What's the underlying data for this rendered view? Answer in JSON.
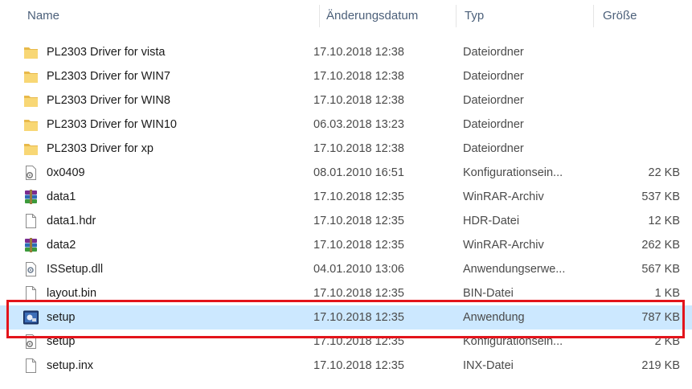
{
  "columns": {
    "name": "Name",
    "date": "Änderungsdatum",
    "type": "Typ",
    "size": "Größe"
  },
  "files": [
    {
      "name": "PL2303 Driver for vista",
      "date": "17.10.2018 12:38",
      "type": "Dateiordner",
      "size": "",
      "icon": "folder-icon"
    },
    {
      "name": "PL2303 Driver for WIN7",
      "date": "17.10.2018 12:38",
      "type": "Dateiordner",
      "size": "",
      "icon": "folder-icon"
    },
    {
      "name": "PL2303 Driver for WIN8",
      "date": "17.10.2018 12:38",
      "type": "Dateiordner",
      "size": "",
      "icon": "folder-icon"
    },
    {
      "name": "PL2303 Driver for WIN10",
      "date": "06.03.2018 13:23",
      "type": "Dateiordner",
      "size": "",
      "icon": "folder-icon"
    },
    {
      "name": "PL2303 Driver for xp",
      "date": "17.10.2018 12:38",
      "type": "Dateiordner",
      "size": "",
      "icon": "folder-icon"
    },
    {
      "name": "0x0409",
      "date": "08.01.2010 16:51",
      "type": "Konfigurationsein...",
      "size": "22 KB",
      "icon": "config-file-icon"
    },
    {
      "name": "data1",
      "date": "17.10.2018 12:35",
      "type": "WinRAR-Archiv",
      "size": "537 KB",
      "icon": "winrar-archive-icon"
    },
    {
      "name": "data1.hdr",
      "date": "17.10.2018 12:35",
      "type": "HDR-Datei",
      "size": "12 KB",
      "icon": "blank-file-icon"
    },
    {
      "name": "data2",
      "date": "17.10.2018 12:35",
      "type": "WinRAR-Archiv",
      "size": "262 KB",
      "icon": "winrar-archive-icon"
    },
    {
      "name": "ISSetup.dll",
      "date": "04.01.2010 13:06",
      "type": "Anwendungserwe...",
      "size": "567 KB",
      "icon": "dll-file-icon"
    },
    {
      "name": "layout.bin",
      "date": "17.10.2018 12:35",
      "type": "BIN-Datei",
      "size": "1 KB",
      "icon": "blank-file-icon"
    },
    {
      "name": "setup",
      "date": "17.10.2018 12:35",
      "type": "Anwendung",
      "size": "787 KB",
      "icon": "setup-app-icon",
      "selected": true
    },
    {
      "name": "setup",
      "date": "17.10.2018 12:35",
      "type": "Konfigurationsein...",
      "size": "2 KB",
      "icon": "config-file-icon"
    },
    {
      "name": "setup.inx",
      "date": "17.10.2018 12:35",
      "type": "INX-Datei",
      "size": "219 KB",
      "icon": "blank-file-icon"
    }
  ],
  "colors": {
    "header_text": "#4c607a",
    "selection": "#cce8ff",
    "highlight_border": "#e3141b",
    "folder": "#f8d775"
  }
}
